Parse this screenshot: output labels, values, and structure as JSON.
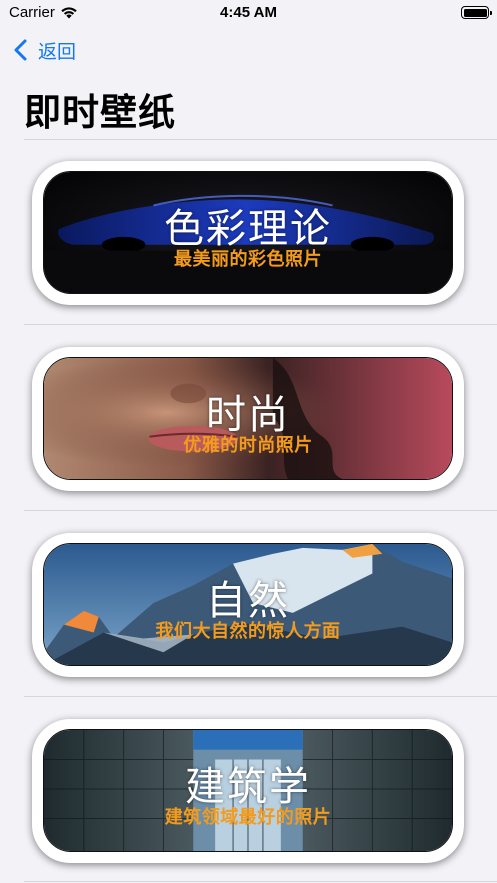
{
  "status_bar": {
    "carrier": "Carrier",
    "time": "4:45 AM"
  },
  "nav": {
    "back_label": "返回",
    "title": "即时壁纸"
  },
  "colors": {
    "accent": "#1478f0",
    "subtitle": "#f39b1c",
    "background": "#f2f2f7"
  },
  "categories": [
    {
      "title": "色彩理论",
      "subtitle": "最美丽的彩色照片",
      "image": "blue-sports-car"
    },
    {
      "title": "时尚",
      "subtitle": "优雅的时尚照片",
      "image": "fashion-portrait"
    },
    {
      "title": "自然",
      "subtitle": "我们大自然的惊人方面",
      "image": "snowy-mountains"
    },
    {
      "title": "建筑学",
      "subtitle": "建筑领域最好的照片",
      "image": "architecture-corridor"
    }
  ]
}
